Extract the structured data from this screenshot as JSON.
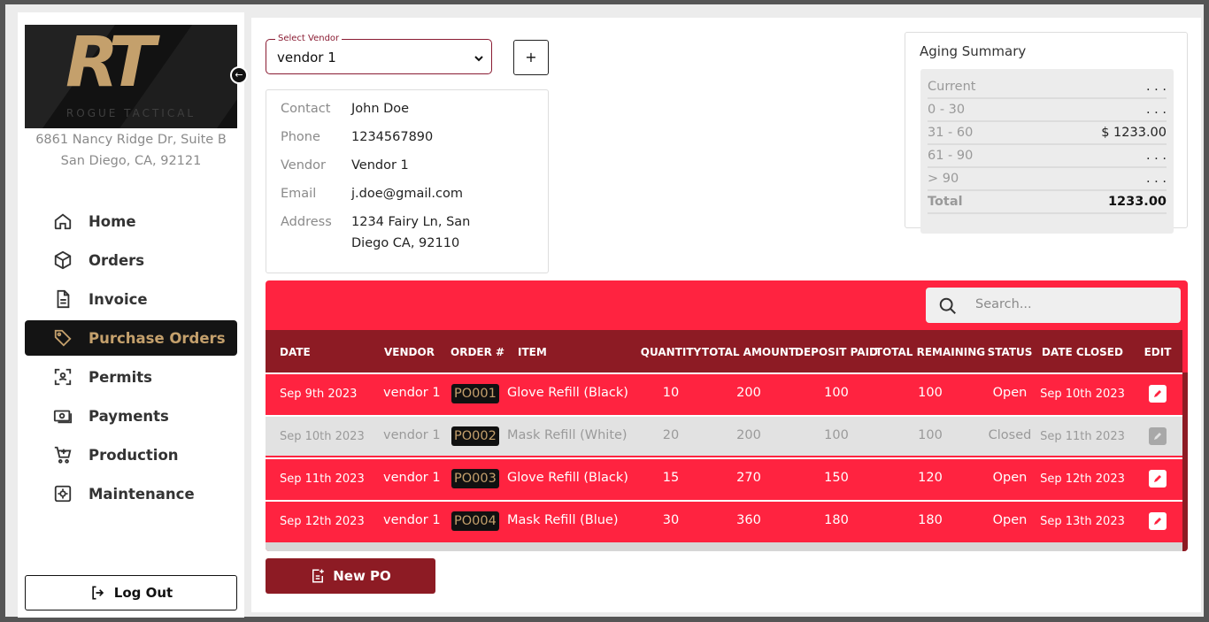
{
  "brand": {
    "logo_mark": "RT",
    "logo_text": "ROGUE TACTICAL"
  },
  "address": {
    "line1": "6861 Nancy Ridge Dr, Suite B",
    "line2": "San Diego, CA, 92121"
  },
  "nav": {
    "items": [
      {
        "label": "Home",
        "icon": "home-icon",
        "active": false
      },
      {
        "label": "Orders",
        "icon": "box-icon",
        "active": false
      },
      {
        "label": "Invoice",
        "icon": "document-icon",
        "active": false
      },
      {
        "label": "Purchase Orders",
        "icon": "tag-icon",
        "active": true
      },
      {
        "label": "Permits",
        "icon": "scan-icon",
        "active": false
      },
      {
        "label": "Payments",
        "icon": "cash-icon",
        "active": false
      },
      {
        "label": "Production",
        "icon": "cart-icon",
        "active": false
      },
      {
        "label": "Maintenance",
        "icon": "gear-icon",
        "active": false
      }
    ],
    "logout_label": "Log Out"
  },
  "vendor_select": {
    "legend": "Select Vendor",
    "value": "vendor 1"
  },
  "add_vendor_label": "+",
  "contact": {
    "contact_key": "Contact",
    "contact_val": "John Doe",
    "phone_key": "Phone",
    "phone_val": "1234567890",
    "vendor_key": "Vendor",
    "vendor_val": "Vendor 1",
    "email_key": "Email",
    "email_val": "j.doe@gmail.com",
    "address_key": "Address",
    "address_line1": "1234 Fairy Ln, San",
    "address_line2": "Diego CA, 92110"
  },
  "aging": {
    "title": "Aging Summary",
    "rows": [
      {
        "label": "Current",
        "amount": ". . ."
      },
      {
        "label": "0 - 30",
        "amount": ". . ."
      },
      {
        "label": "31 - 60",
        "amount": "$ 1233.00"
      },
      {
        "label": "61 - 90",
        "amount": ". . ."
      },
      {
        "label": "> 90",
        "amount": ". . ."
      }
    ],
    "total_label": "Total",
    "total_amount": "1233.00"
  },
  "search": {
    "placeholder": "Search..."
  },
  "table": {
    "headers": {
      "date": "DATE",
      "vendor": "VENDOR",
      "order": "ORDER #",
      "item": "ITEM",
      "quantity": "QUANTITY",
      "total_amount": "TOTAL AMOUNT",
      "deposit_paid": "DEPOSIT PAID",
      "total_remaining": "TOTAL REMAINING",
      "status": "STATUS",
      "date_closed": "DATE CLOSED",
      "edit": "EDIT"
    },
    "rows": [
      {
        "date": "Sep 9th 2023",
        "vendor": "vendor 1",
        "order": "PO001",
        "item": "Glove Refill (Black)",
        "quantity": "10",
        "total_amount": "200",
        "deposit_paid": "100",
        "total_remaining": "100",
        "status": "Open",
        "date_closed": "Sep 10th 2023"
      },
      {
        "date": "Sep 10th 2023",
        "vendor": "vendor 1",
        "order": "PO002",
        "item": "Mask Refill (White)",
        "quantity": "20",
        "total_amount": "200",
        "deposit_paid": "100",
        "total_remaining": "100",
        "status": "Closed",
        "date_closed": "Sep 11th 2023"
      },
      {
        "date": "Sep 11th 2023",
        "vendor": "vendor 1",
        "order": "PO003",
        "item": "Glove Refill (Black)",
        "quantity": "15",
        "total_amount": "270",
        "deposit_paid": "150",
        "total_remaining": "120",
        "status": "Open",
        "date_closed": "Sep 12th 2023"
      },
      {
        "date": "Sep 12th 2023",
        "vendor": "vendor 1",
        "order": "PO004",
        "item": "Mask Refill (Blue)",
        "quantity": "30",
        "total_amount": "360",
        "deposit_paid": "180",
        "total_remaining": "180",
        "status": "Open",
        "date_closed": "Sep 13th 2023"
      }
    ]
  },
  "new_po_label": "New PO",
  "colors": {
    "accent_red": "#ff2340",
    "dark_red": "#8d1b24",
    "gold": "#c4a06c",
    "closed_row": "#e2e2e2"
  }
}
